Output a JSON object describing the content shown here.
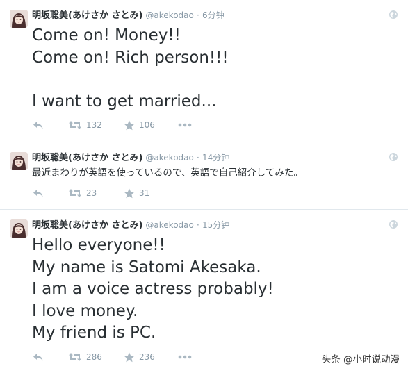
{
  "tweets": [
    {
      "name": "明坂聡美(あけさか さとみ)",
      "handle": "@akekodao",
      "separator": "·",
      "time": "6分钟",
      "text": "Come on! Money!!\nCome on! Rich person!!!\n\nI want to get married...",
      "retweets": "132",
      "favorites": "106"
    },
    {
      "name": "明坂聡美(あけさか さとみ)",
      "handle": "@akekodao",
      "separator": "·",
      "time": "14分钟",
      "text": "最近まわりが英語を使っているので、英語で自己紹介してみた。",
      "retweets": "23",
      "favorites": "31"
    },
    {
      "name": "明坂聡美(あけさか さとみ)",
      "handle": "@akekodao",
      "separator": "·",
      "time": "15分钟",
      "text": "Hello everyone!!\nMy name is Satomi Akesaka.\nI am a voice actress probably!\nI love money.\nMy friend is PC.",
      "retweets": "286",
      "favorites": "236"
    }
  ],
  "icons": {
    "reply": "reply-icon",
    "retweet": "retweet-icon",
    "favorite": "star-icon",
    "more": "more-icon",
    "globe": "globe-icon"
  },
  "colors": {
    "text": "#292f33",
    "muted": "#8899a6",
    "divider": "#e1e8ed"
  },
  "watermark": "头条 @小时说动漫"
}
